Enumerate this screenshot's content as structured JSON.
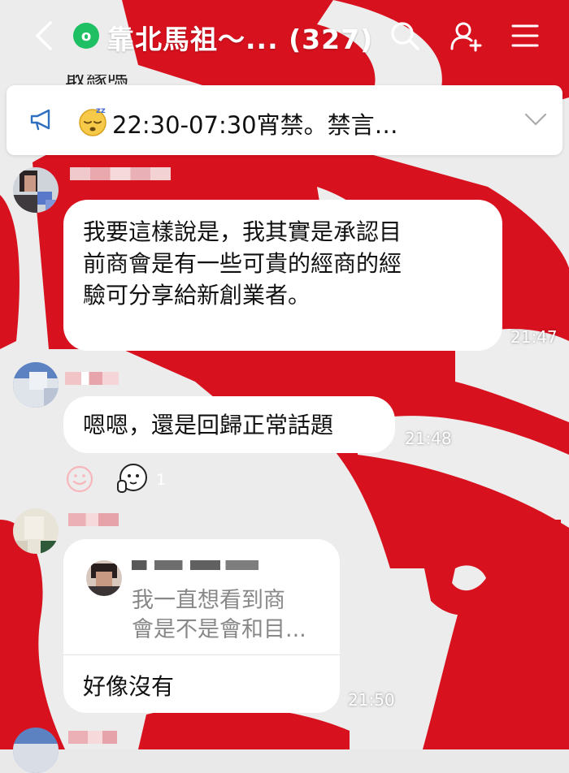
{
  "header": {
    "group_badge": "o",
    "title": "靠北馬祖～... (327)",
    "icons": [
      "back-icon",
      "search-icon",
      "add-friend-icon",
      "menu-icon"
    ],
    "text_color": "#ffffff"
  },
  "announcement": {
    "partial_behind_text": "敢緣嗎",
    "emoji": "sleeping-face-emoji",
    "text": "22:30-07:30宵禁。禁言…",
    "icons": [
      "megaphone-icon",
      "chevron-down-icon"
    ]
  },
  "messages": [
    {
      "text_lines": [
        "我要這樣說是，我其實是承認目",
        "前商會是有一些可貴的經商的經",
        "驗可分享給新創業者。"
      ],
      "time": "21:47"
    },
    {
      "text": "嗯嗯，還是回歸正常話題",
      "time": "21:48",
      "reactions": {
        "count": "1",
        "icons": [
          "add-reaction-icon",
          "shy-face-emoji"
        ]
      }
    },
    {
      "quote_lines": [
        "我一直想看到商",
        "會是不是會和目..."
      ],
      "text": "好像沒有",
      "time": "21:50"
    }
  ],
  "colors": {
    "accent_red": "#d8111e",
    "badge_green": "#1fbf63",
    "bubble": "#ffffff"
  }
}
